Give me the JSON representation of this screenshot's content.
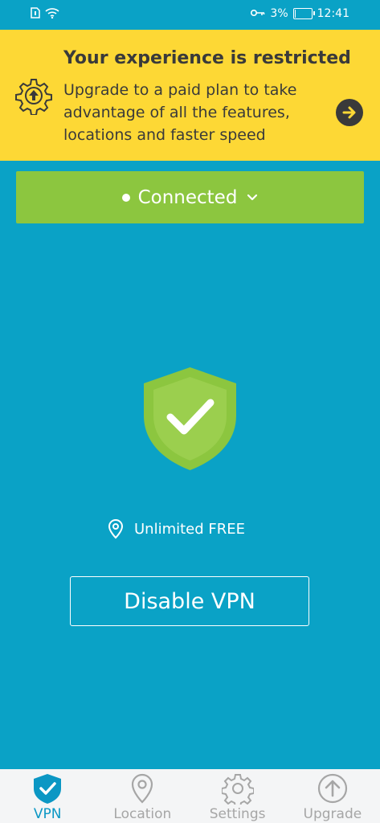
{
  "status_bar": {
    "battery": "3%",
    "battery_level": 0.03,
    "time": "12:41"
  },
  "banner": {
    "title": "Your experience is restricted",
    "message": "Upgrade to a paid plan to take advantage of all the features, locations and faster speed"
  },
  "connection": {
    "label": "Connected"
  },
  "location": {
    "label": "Unlimited FREE"
  },
  "action": {
    "disable_label": "Disable VPN"
  },
  "nav": {
    "items": [
      {
        "label": "VPN",
        "icon": "shield-check-icon",
        "active": true
      },
      {
        "label": "Location",
        "icon": "location-pin-icon",
        "active": false
      },
      {
        "label": "Settings",
        "icon": "gear-icon",
        "active": false
      },
      {
        "label": "Upgrade",
        "icon": "upgrade-arrow-icon",
        "active": false
      }
    ]
  },
  "colors": {
    "background": "#0aa2c6",
    "banner": "#fdd835",
    "connected": "#8cc63f",
    "active_nav": "#0b97c4",
    "inactive_nav": "#a6a6a6"
  }
}
